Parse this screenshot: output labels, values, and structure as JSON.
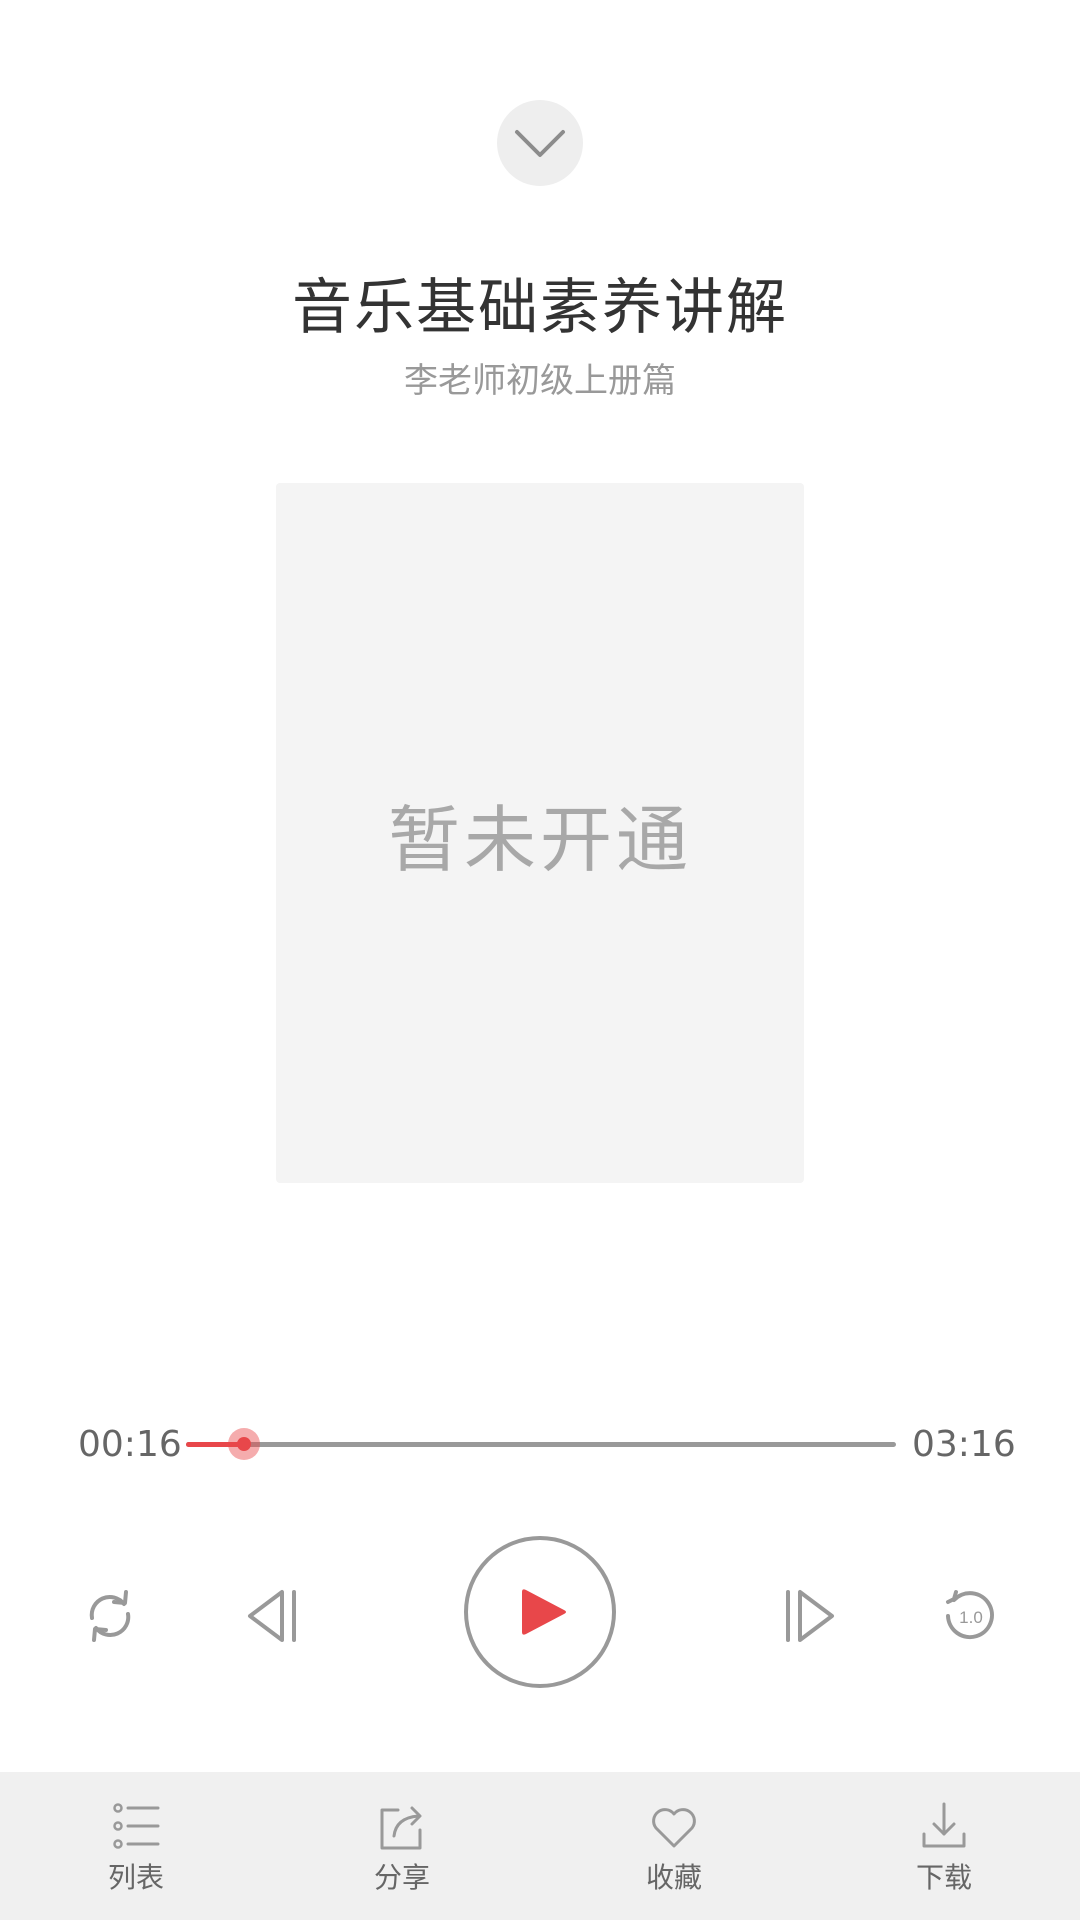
{
  "header": {
    "title": "音乐基础素养讲解",
    "subtitle": "李老师初级上册篇"
  },
  "cover": {
    "placeholder_text": "暂未开通"
  },
  "progress": {
    "current_time": "00:16",
    "total_time": "03:16",
    "fraction": 0.082,
    "accent_color": "#e8474a"
  },
  "controls": {
    "loop_icon": "loop-icon",
    "prev_icon": "previous-icon",
    "play_icon": "play-icon",
    "next_icon": "next-icon",
    "speed_icon": "speed-icon",
    "speed_value": "1.0"
  },
  "bottom_bar": {
    "items": [
      {
        "label": "列表",
        "icon": "list-icon"
      },
      {
        "label": "分享",
        "icon": "share-icon"
      },
      {
        "label": "收藏",
        "icon": "heart-icon"
      },
      {
        "label": "下载",
        "icon": "download-icon"
      }
    ]
  }
}
